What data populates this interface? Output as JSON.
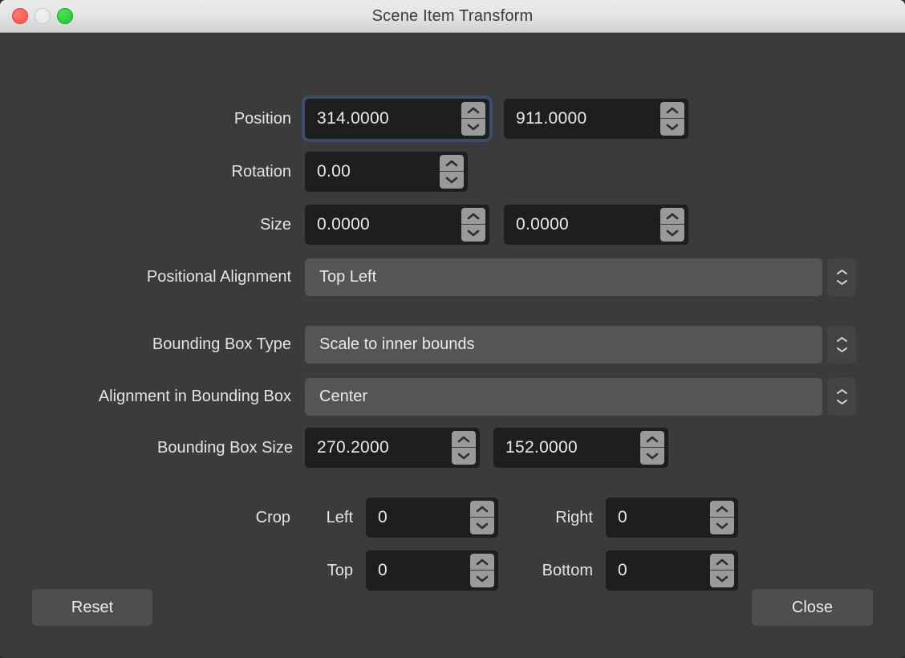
{
  "window": {
    "title": "Scene Item Transform",
    "traffic_lights": [
      {
        "name": "close",
        "color": "#f9544a"
      },
      {
        "name": "minimize",
        "color": "#e3e3e3"
      },
      {
        "name": "maximize",
        "color": "#1fc32e"
      }
    ],
    "background_color": "#3b3b3b",
    "focus_ring_color": "#3d4d66"
  },
  "form": {
    "position": {
      "label": "Position",
      "x": "314.0000",
      "y": "911.0000",
      "focused_field": "x"
    },
    "rotation": {
      "label": "Rotation",
      "value": "0.00"
    },
    "size": {
      "label": "Size",
      "width": "0.0000",
      "height": "0.0000"
    },
    "positional_alignment": {
      "label": "Positional Alignment",
      "value": "Top Left"
    },
    "bounding_box_type": {
      "label": "Bounding Box Type",
      "value": "Scale to inner bounds"
    },
    "alignment_in_bounding_box": {
      "label": "Alignment in Bounding Box",
      "value": "Center"
    },
    "bounding_box_size": {
      "label": "Bounding Box Size",
      "width": "270.2000",
      "height": "152.0000"
    },
    "crop": {
      "label": "Crop",
      "left_label": "Left",
      "left_value": "0",
      "right_label": "Right",
      "right_value": "0",
      "top_label": "Top",
      "top_value": "0",
      "bottom_label": "Bottom",
      "bottom_value": "0"
    }
  },
  "footer": {
    "reset_label": "Reset",
    "close_label": "Close"
  },
  "icons": {
    "chevron_up": "chevron-up-icon",
    "chevron_down": "chevron-down-icon"
  }
}
